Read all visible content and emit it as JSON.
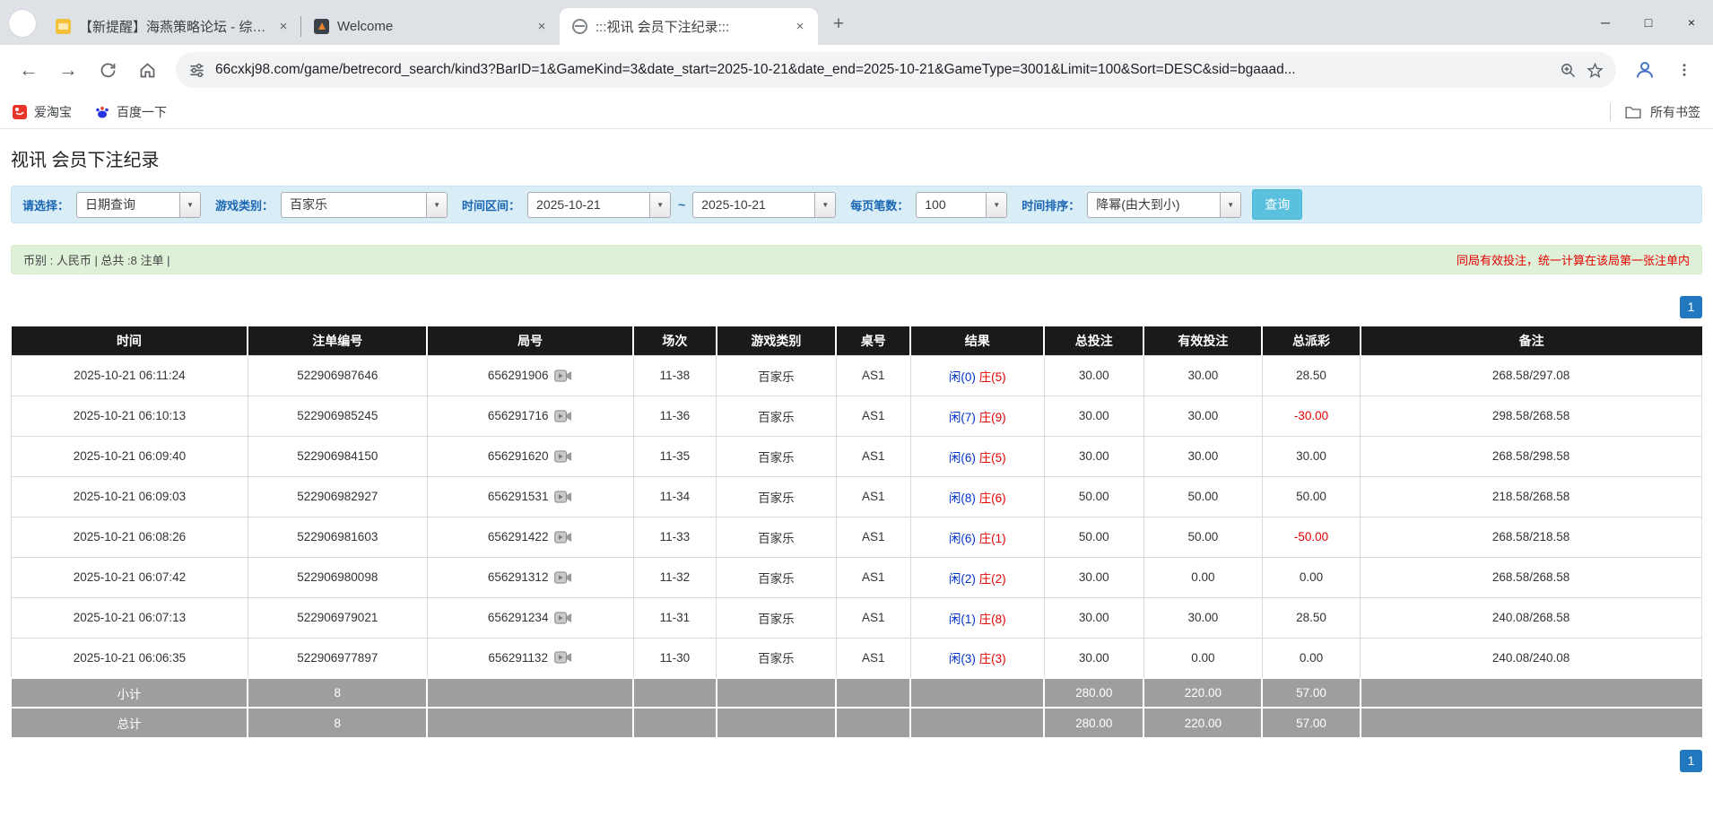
{
  "colors": {
    "accent": "#2178be",
    "link": "#2178be",
    "button": "#5bc0de",
    "filter_bg": "#d9edf7",
    "info_bg": "#dff0d8",
    "header_bg": "#1a1a1a",
    "footer_bg": "#9e9e9e",
    "player": "#0033cc",
    "banker": "#e60000",
    "negative": "#e60000"
  },
  "browser": {
    "tabs": [
      {
        "title": "【新提醒】海燕策略论坛 - 综合...",
        "close": "×"
      },
      {
        "title": "Welcome",
        "close": "×"
      },
      {
        "title": ":::视讯 会员下注纪录:::",
        "close": "×"
      }
    ],
    "new_tab_button": "+",
    "window_controls": {
      "minimize": "─",
      "maximize": "□",
      "close": "×"
    },
    "nav": {
      "back": "←",
      "forward": "→"
    },
    "url": "66cxkj98.com/game/betrecord_search/kind3?BarID=1&GameKind=3&date_start=2025-10-21&date_end=2025-10-21&GameType=3001&Limit=100&Sort=DESC&sid=bgaaad...",
    "bookmarks": [
      {
        "label": "爱淘宝"
      },
      {
        "label": "百度一下"
      }
    ],
    "all_bookmarks_label": "所有书签"
  },
  "page": {
    "title": "视讯 会员下注纪录",
    "filters": {
      "select_label": "请选择：",
      "select_value": "日期查询",
      "game_label": "游戏类别：",
      "game_value": "百家乐",
      "range_label": "时间区间：",
      "date_start": "2025-10-21",
      "range_separator": "~",
      "date_end": "2025-10-21",
      "page_size_label": "每页笔数：",
      "page_size_value": "100",
      "sort_label": "时间排序：",
      "sort_value": "降幂(由大到小)",
      "search_button": "查询"
    },
    "info_bar": {
      "summary": "币别 : 人民币 | 总共 :8 注单 |",
      "notice": "同局有效投注，统一计算在该局第一张注单内"
    },
    "pagination": {
      "page": "1"
    },
    "table": {
      "headers": [
        "时间",
        "注单编号",
        "局号",
        "场次",
        "游戏类别",
        "桌号",
        "结果",
        "总投注",
        "有效投注",
        "总派彩",
        "备注"
      ],
      "rows": [
        {
          "time": "2025-10-21 06:11:24",
          "bet_id": "522906987646",
          "round": "656291906",
          "session": "11-38",
          "game": "百家乐",
          "table_no": "AS1",
          "player": "闲(0)",
          "banker": "庄(5)",
          "total_bet": "30.00",
          "valid_bet": "30.00",
          "payout": "28.50",
          "note": "268.58/297.08"
        },
        {
          "time": "2025-10-21 06:10:13",
          "bet_id": "522906985245",
          "round": "656291716",
          "session": "11-36",
          "game": "百家乐",
          "table_no": "AS1",
          "player": "闲(7)",
          "banker": "庄(9)",
          "total_bet": "30.00",
          "valid_bet": "30.00",
          "payout": "-30.00",
          "note": "298.58/268.58"
        },
        {
          "time": "2025-10-21 06:09:40",
          "bet_id": "522906984150",
          "round": "656291620",
          "session": "11-35",
          "game": "百家乐",
          "table_no": "AS1",
          "player": "闲(6)",
          "banker": "庄(5)",
          "total_bet": "30.00",
          "valid_bet": "30.00",
          "payout": "30.00",
          "note": "268.58/298.58"
        },
        {
          "time": "2025-10-21 06:09:03",
          "bet_id": "522906982927",
          "round": "656291531",
          "session": "11-34",
          "game": "百家乐",
          "table_no": "AS1",
          "player": "闲(8)",
          "banker": "庄(6)",
          "total_bet": "50.00",
          "valid_bet": "50.00",
          "payout": "50.00",
          "note": "218.58/268.58"
        },
        {
          "time": "2025-10-21 06:08:26",
          "bet_id": "522906981603",
          "round": "656291422",
          "session": "11-33",
          "game": "百家乐",
          "table_no": "AS1",
          "player": "闲(6)",
          "banker": "庄(1)",
          "total_bet": "50.00",
          "valid_bet": "50.00",
          "payout": "-50.00",
          "note": "268.58/218.58"
        },
        {
          "time": "2025-10-21 06:07:42",
          "bet_id": "522906980098",
          "round": "656291312",
          "session": "11-32",
          "game": "百家乐",
          "table_no": "AS1",
          "player": "闲(2)",
          "banker": "庄(2)",
          "total_bet": "30.00",
          "valid_bet": "0.00",
          "payout": "0.00",
          "note": "268.58/268.58"
        },
        {
          "time": "2025-10-21 06:07:13",
          "bet_id": "522906979021",
          "round": "656291234",
          "session": "11-31",
          "game": "百家乐",
          "table_no": "AS1",
          "player": "闲(1)",
          "banker": "庄(8)",
          "total_bet": "30.00",
          "valid_bet": "30.00",
          "payout": "28.50",
          "note": "240.08/268.58"
        },
        {
          "time": "2025-10-21 06:06:35",
          "bet_id": "522906977897",
          "round": "656291132",
          "session": "11-30",
          "game": "百家乐",
          "table_no": "AS1",
          "player": "闲(3)",
          "banker": "庄(3)",
          "total_bet": "30.00",
          "valid_bet": "0.00",
          "payout": "0.00",
          "note": "240.08/240.08"
        }
      ],
      "subtotal": {
        "label": "小计",
        "count": "8",
        "total_bet": "280.00",
        "valid_bet": "220.00",
        "payout": "57.00"
      },
      "total": {
        "label": "总计",
        "count": "8",
        "total_bet": "280.00",
        "valid_bet": "220.00",
        "payout": "57.00"
      }
    }
  }
}
